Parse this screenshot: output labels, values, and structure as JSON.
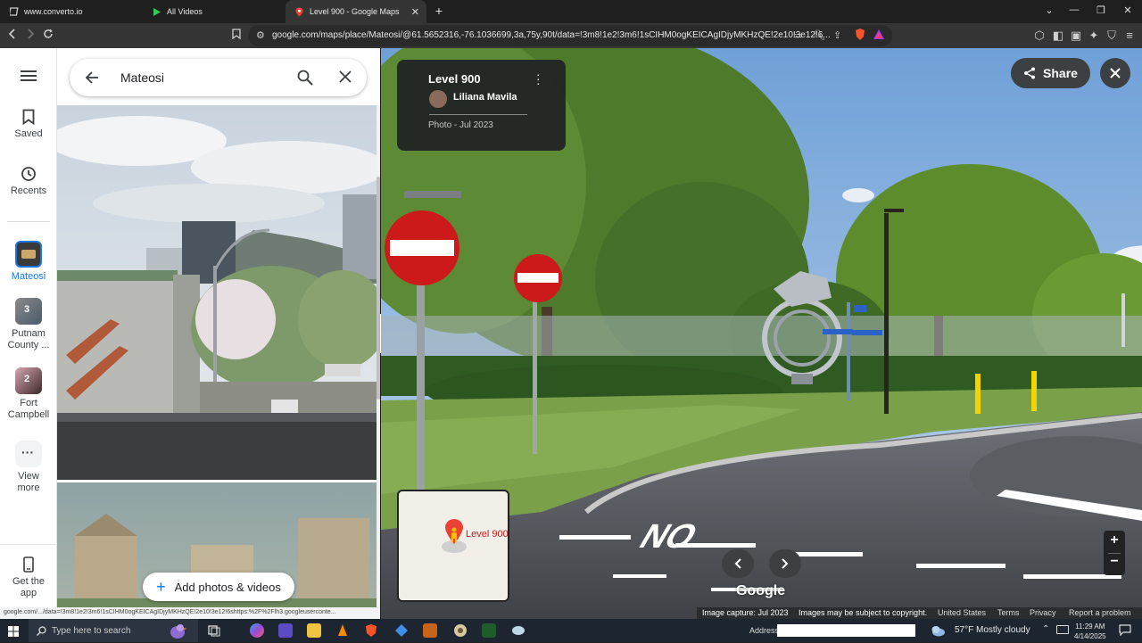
{
  "browser": {
    "tabs": [
      {
        "title": "www.converto.io",
        "active": false
      },
      {
        "title": "All Videos",
        "active": false
      },
      {
        "title": "Level 900 - Google Maps",
        "active": true
      }
    ],
    "url": "google.com/maps/place/Mateosi/@61.5652316,-76.1036699,3a,75y,90t/data=!3m8!1e2!3m6!1sCIHM0ogKEICAgIDjyMKHzQE!2e10!3e12!6..."
  },
  "sidebar": {
    "menu_icon": "hamburger-icon",
    "items": [
      {
        "label": "Saved",
        "icon": "bookmark-icon"
      },
      {
        "label": "Recents",
        "icon": "history-icon"
      },
      {
        "label": "Mateosi",
        "icon": "place-thumbnail"
      },
      {
        "label": "Putnam County ...",
        "badge": "3"
      },
      {
        "label": "Fort Campbell",
        "badge": "2"
      },
      {
        "label": "View more",
        "icon": "more-icon"
      },
      {
        "label": "Get the app",
        "icon": "phone-icon"
      }
    ]
  },
  "search": {
    "query": "Mateosi"
  },
  "panel": {
    "add_button": "Add photos & videos"
  },
  "viewer": {
    "place_title": "Level 900",
    "author": "Liliana Mavila",
    "photo_meta": "Photo - Jul 2023",
    "share_label": "Share",
    "minimap_label": "Level 900",
    "google_logo": "Google",
    "footer": {
      "capture": "Image capture: Jul 2023",
      "copyright": "Images may be subject to copyright.",
      "country": "United States",
      "terms": "Terms",
      "privacy": "Privacy",
      "report": "Report a problem"
    }
  },
  "status_url": "google.com/.../data=!3m8!1e2!3m6!1sCIHM0ogKEICAgIDjyMKHzQE!2e10!3e12!6shttps:%2F%2Flh3.googleuserconte...",
  "taskbar": {
    "search_placeholder": "Type here to search",
    "address_label": "Address",
    "weather": "57°F  Mostly cloudy",
    "time": "11:29 AM",
    "date": "4/14/2025"
  }
}
